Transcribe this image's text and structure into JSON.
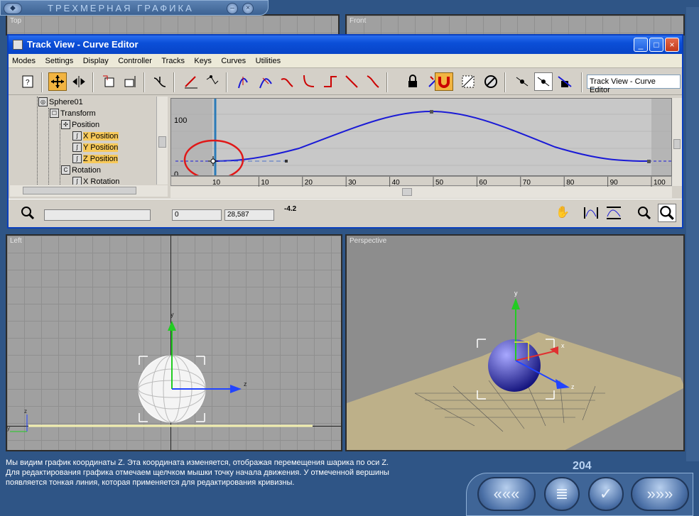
{
  "app": {
    "title": "ТРЕХМЕРНАЯ ГРАФИКА",
    "minimize": "–",
    "close": "×"
  },
  "viewports": {
    "top": "Top",
    "front": "Front",
    "left": "Left",
    "perspective": "Perspective"
  },
  "window": {
    "title": "Track View - Curve Editor",
    "min": "_",
    "max": "□",
    "close": "×"
  },
  "menu": [
    "Modes",
    "Settings",
    "Display",
    "Controller",
    "Tracks",
    "Keys",
    "Curves",
    "Utilities"
  ],
  "toolbar": {
    "name_field": "Track View - Curve Editor"
  },
  "tree": {
    "items": [
      {
        "label": "Sphere01",
        "icon": "object-icon"
      },
      {
        "label": "Transform",
        "icon": "transform-icon"
      },
      {
        "label": "Position",
        "icon": "position-icon"
      },
      {
        "label": "X Position",
        "icon": "curve-track-icon"
      },
      {
        "label": "Y Position",
        "icon": "curve-track-icon"
      },
      {
        "label": "Z Position",
        "icon": "curve-track-icon"
      },
      {
        "label": "Rotation",
        "icon": "rotation-icon"
      },
      {
        "label": "X Rotation",
        "icon": "curve-track-icon"
      }
    ]
  },
  "curve": {
    "y_label": "100",
    "y_zero": "0",
    "ticks": [
      "10",
      "20",
      "30",
      "40",
      "50",
      "60",
      "70",
      "80",
      "90",
      "100"
    ],
    "frame_marker": "10"
  },
  "status": {
    "frame": "0",
    "value": "28,587",
    "icon_text": "-4.2"
  },
  "caption": {
    "lines": [
      "Мы видим график координаты Z. Эта координата изменяется, отображая перемещения шарика по оси Z.",
      "Для редактирования графика отмечаем щелчком мышки точку начала движения. У отмеченной вершины",
      "появляется тонкая линия, которая применяется для редактирования кривизны."
    ]
  },
  "page_number": "204",
  "axes": {
    "x": "x",
    "y": "y",
    "z": "z"
  },
  "colors": {
    "curve": "#1a1ad6",
    "selection": "#f7c95a",
    "highlight_circle": "#e01818"
  }
}
